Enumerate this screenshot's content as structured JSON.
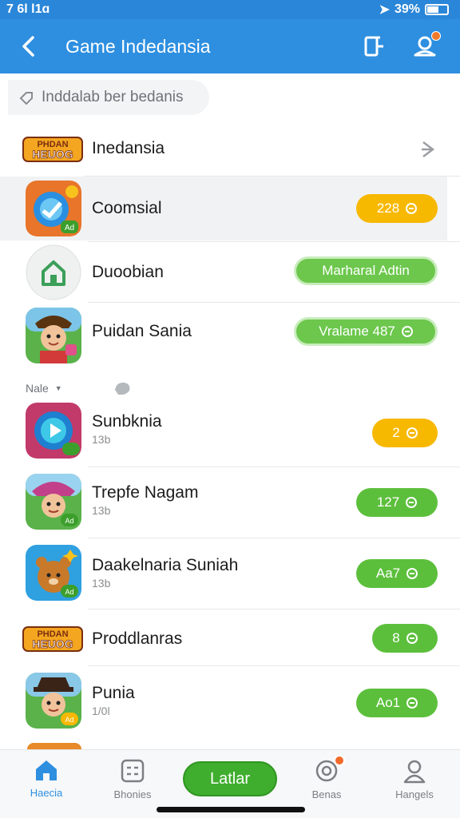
{
  "status": {
    "time": "7 6l l1ɑ",
    "battery": "39%"
  },
  "header": {
    "title": "Game Indedansia"
  },
  "search": {
    "text": "Inddalab ber bedanis"
  },
  "items": [
    {
      "name": "Inedansia",
      "action": ""
    },
    {
      "name": "Coomsial",
      "badge": "Ad",
      "pill": "228"
    },
    {
      "name": "Duoobian",
      "pill": "Marharal   Adtin"
    },
    {
      "name": "Puidan Sania",
      "pill": "Vralame  487"
    },
    {
      "name": "Sunbknia",
      "sub": "13b",
      "pill": "2"
    },
    {
      "name": "Trepfe Nagam",
      "sub": "13b",
      "badge": "Ad",
      "pill": "127"
    },
    {
      "name": "Daakelnaria Suniah",
      "sub": "13b",
      "badge": "Ad",
      "pill": "Aa7"
    },
    {
      "name": "Proddlanras",
      "pill": "8"
    },
    {
      "name": "Punia",
      "sub": "1/0l",
      "badge": "Ad",
      "pill": "Ao1"
    }
  ],
  "section_label": "Nale",
  "logo_text": [
    "PHDAN",
    "HEUOG"
  ],
  "colors": {
    "primary": "#2e8fe0",
    "green": "#5cbf3c",
    "yellow": "#f7b800"
  },
  "nav": [
    {
      "label": "Haecia",
      "icon": "home-icon"
    },
    {
      "label": "Bhonies",
      "icon": "list-icon"
    },
    {
      "label": "Latlar",
      "icon": ""
    },
    {
      "label": "Benas",
      "icon": "target-icon"
    },
    {
      "label": "Hangels",
      "icon": "person-icon"
    }
  ]
}
